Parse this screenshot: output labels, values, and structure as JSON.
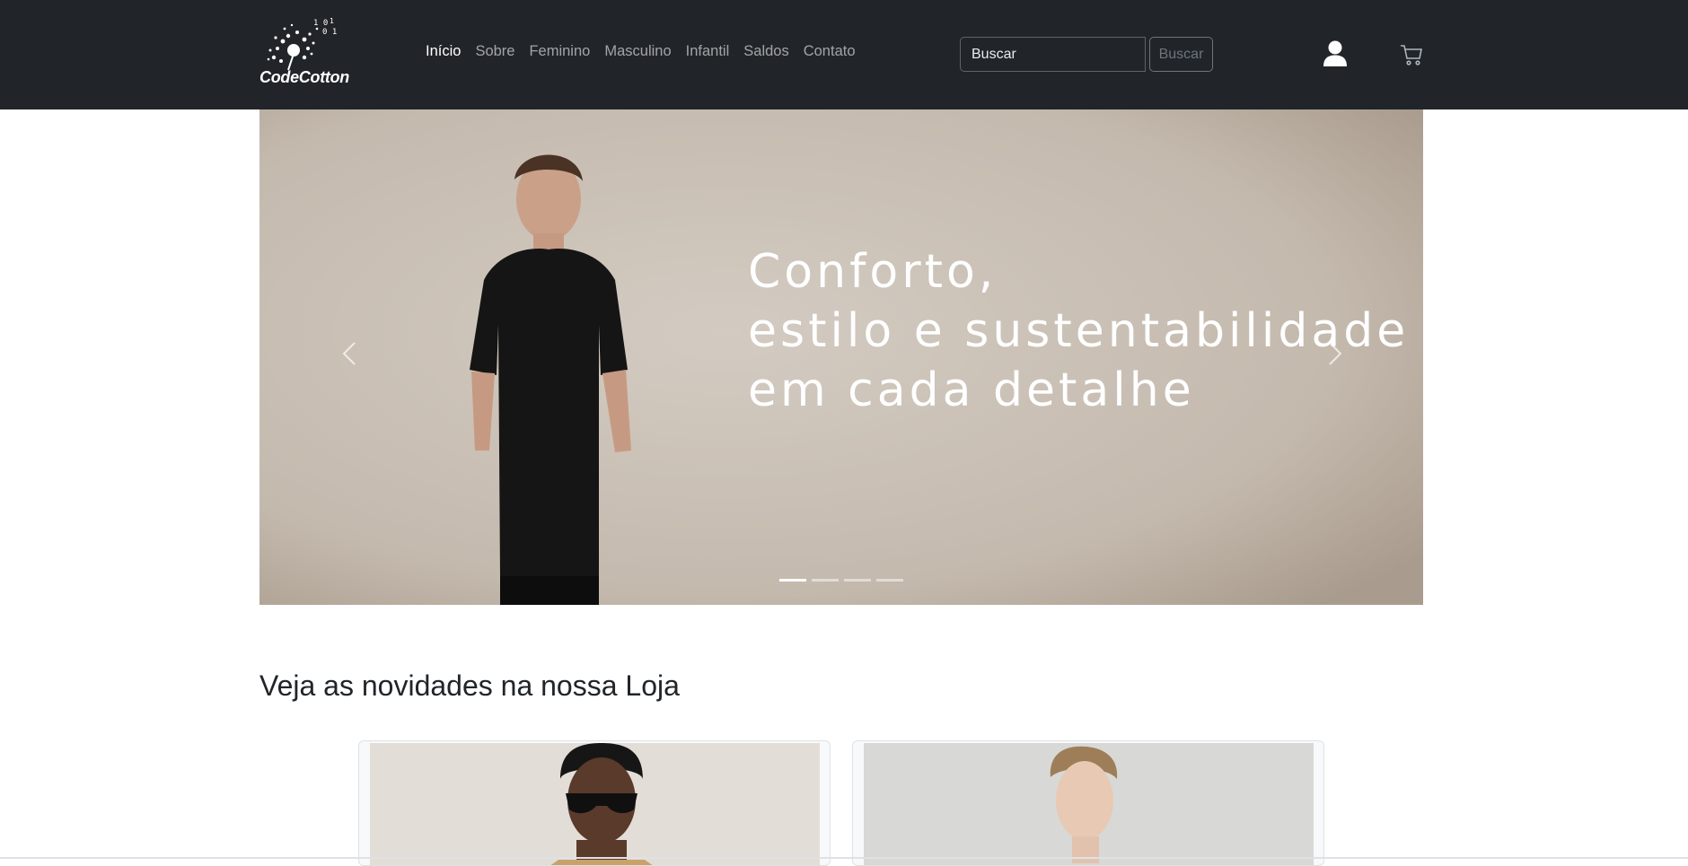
{
  "brand": {
    "name": "CodeCotton",
    "logo_icon": "dandelion-logo-icon"
  },
  "nav": {
    "items": [
      {
        "label": "Início",
        "active": true
      },
      {
        "label": "Sobre",
        "active": false
      },
      {
        "label": "Feminino",
        "active": false
      },
      {
        "label": "Masculino",
        "active": false
      },
      {
        "label": "Infantil",
        "active": false
      },
      {
        "label": "Saldos",
        "active": false
      },
      {
        "label": "Contato",
        "active": false
      }
    ]
  },
  "search": {
    "placeholder": "Buscar",
    "button_label": "Buscar"
  },
  "icons": {
    "user": "user-icon",
    "cart": "cart-icon"
  },
  "hero": {
    "lines": [
      "Conforto,",
      "estilo e sustentabilidade",
      "em cada detalhe"
    ],
    "slide_count": 4,
    "active_slide": 1
  },
  "section": {
    "title": "Veja as novidades na nossa Loja"
  },
  "colors": {
    "navbar": "#212529",
    "hero_bg": "#c6bcb1",
    "text": "#212529"
  }
}
